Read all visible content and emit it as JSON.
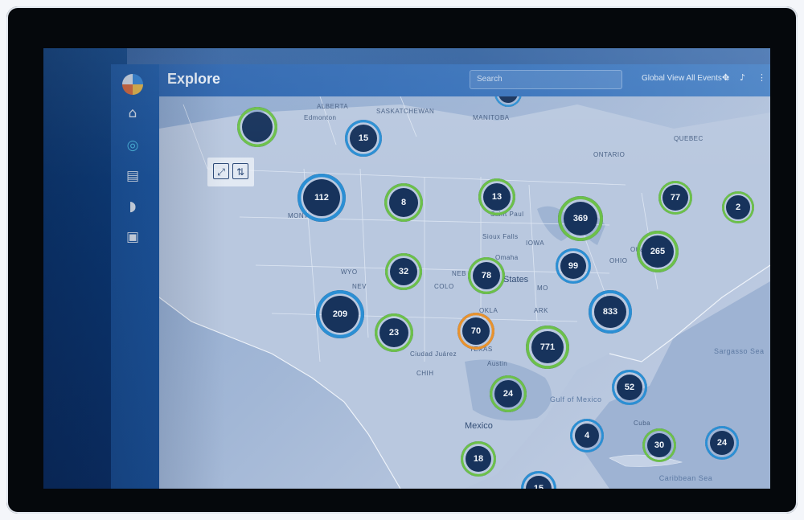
{
  "app": {
    "page_title": "Explore",
    "search_placeholder": "Search",
    "view_selector": "Global View All Events ⌄"
  },
  "sidebar": {
    "items": [
      {
        "name": "home",
        "icon": "⌂"
      },
      {
        "name": "map",
        "icon": "◎"
      },
      {
        "name": "stores",
        "icon": "▤"
      },
      {
        "name": "chat",
        "icon": "◗"
      },
      {
        "name": "reports",
        "icon": "▣"
      }
    ]
  },
  "map_controls": {
    "expand_icon": "⤢",
    "sort_icon": "⇅"
  },
  "map_labels": {
    "alberta": "ALBERTA",
    "saskatchewan": "SASKATCHEWAN",
    "edmonton": "Edmonton",
    "manitoba": "MANITOBA",
    "ontario": "ONTARIO",
    "quebec": "QUEBEC",
    "saint_paul": "Saint Paul",
    "sioux_falls": "Sioux Falls",
    "omaha": "Omaha",
    "iowa": "IOWA",
    "united_states": "States",
    "colo": "COLO",
    "nev": "NEV",
    "okla": "OKLA",
    "texas": "TEXAS",
    "austin": "Austin",
    "ciudad_juarez": "Ciudad Juárez",
    "chih": "CHIH",
    "mexico": "Mexico",
    "gulf_of_mexico": "Gulf of Mexico",
    "cuba": "Cuba",
    "sargasso_sea": "Sargasso Sea",
    "caribbean_sea": "Caribbean Sea",
    "ohio": "OHIO",
    "ottawa": "Ottawa",
    "montana": "MONT",
    "wyo": "WYO",
    "neb": "NEB",
    "mo": "MO",
    "ark": "ARK"
  },
  "clusters": [
    {
      "count": "",
      "ring": [
        "#2b8fd4",
        "#6cc04a"
      ]
    },
    {
      "count": "15",
      "ring": [
        "#2b8fd4",
        "#2b8fd4"
      ]
    },
    {
      "count": "",
      "ring": [
        "#e8922e",
        "#2b8fd4"
      ]
    },
    {
      "count": "112",
      "ring": [
        "#2b8fd4",
        "#2b8fd4"
      ]
    },
    {
      "count": "8",
      "ring": [
        "#e8922e",
        "#6cc04a"
      ]
    },
    {
      "count": "13",
      "ring": [
        "#e8922e",
        "#6cc04a"
      ]
    },
    {
      "count": "369",
      "ring": [
        "#2b8fd4",
        "#6cc04a"
      ]
    },
    {
      "count": "77",
      "ring": [
        "#6cc04a",
        "#6cc04a"
      ]
    },
    {
      "count": "2",
      "ring": [
        "#6cc04a",
        "#6cc04a"
      ]
    },
    {
      "count": "32",
      "ring": [
        "#2b8fd4",
        "#6cc04a"
      ]
    },
    {
      "count": "78",
      "ring": [
        "#2b8fd4",
        "#6cc04a"
      ]
    },
    {
      "count": "99",
      "ring": [
        "#2b8fd4",
        "#2b8fd4"
      ]
    },
    {
      "count": "265",
      "ring": [
        "#2b8fd4",
        "#6cc04a"
      ]
    },
    {
      "count": "209",
      "ring": [
        "#2b8fd4",
        "#2b8fd4"
      ]
    },
    {
      "count": "23",
      "ring": [
        "#2b8fd4",
        "#6cc04a"
      ]
    },
    {
      "count": "70",
      "ring": [
        "#6cc04a",
        "#e8922e"
      ]
    },
    {
      "count": "833",
      "ring": [
        "#6cc04a",
        "#2b8fd4"
      ]
    },
    {
      "count": "771",
      "ring": [
        "#2b8fd4",
        "#6cc04a"
      ]
    },
    {
      "count": "24",
      "ring": [
        "#2b8fd4",
        "#6cc04a"
      ]
    },
    {
      "count": "52",
      "ring": [
        "#2b8fd4",
        "#2b8fd4"
      ]
    },
    {
      "count": "4",
      "ring": [
        "#e8922e",
        "#2b8fd4"
      ]
    },
    {
      "count": "30",
      "ring": [
        "#e8922e",
        "#6cc04a"
      ]
    },
    {
      "count": "24",
      "ring": [
        "#2b8fd4",
        "#2b8fd4"
      ]
    },
    {
      "count": "18",
      "ring": [
        "#2b8fd4",
        "#6cc04a"
      ]
    },
    {
      "count": "15",
      "ring": [
        "#6cc04a",
        "#2b8fd4"
      ]
    }
  ],
  "colors": {
    "accent": "#2b8fd4",
    "green": "#6cc04a",
    "orange": "#e8922e",
    "cluster_fill": "#17335c",
    "sidebar": "#1f5ca8"
  }
}
